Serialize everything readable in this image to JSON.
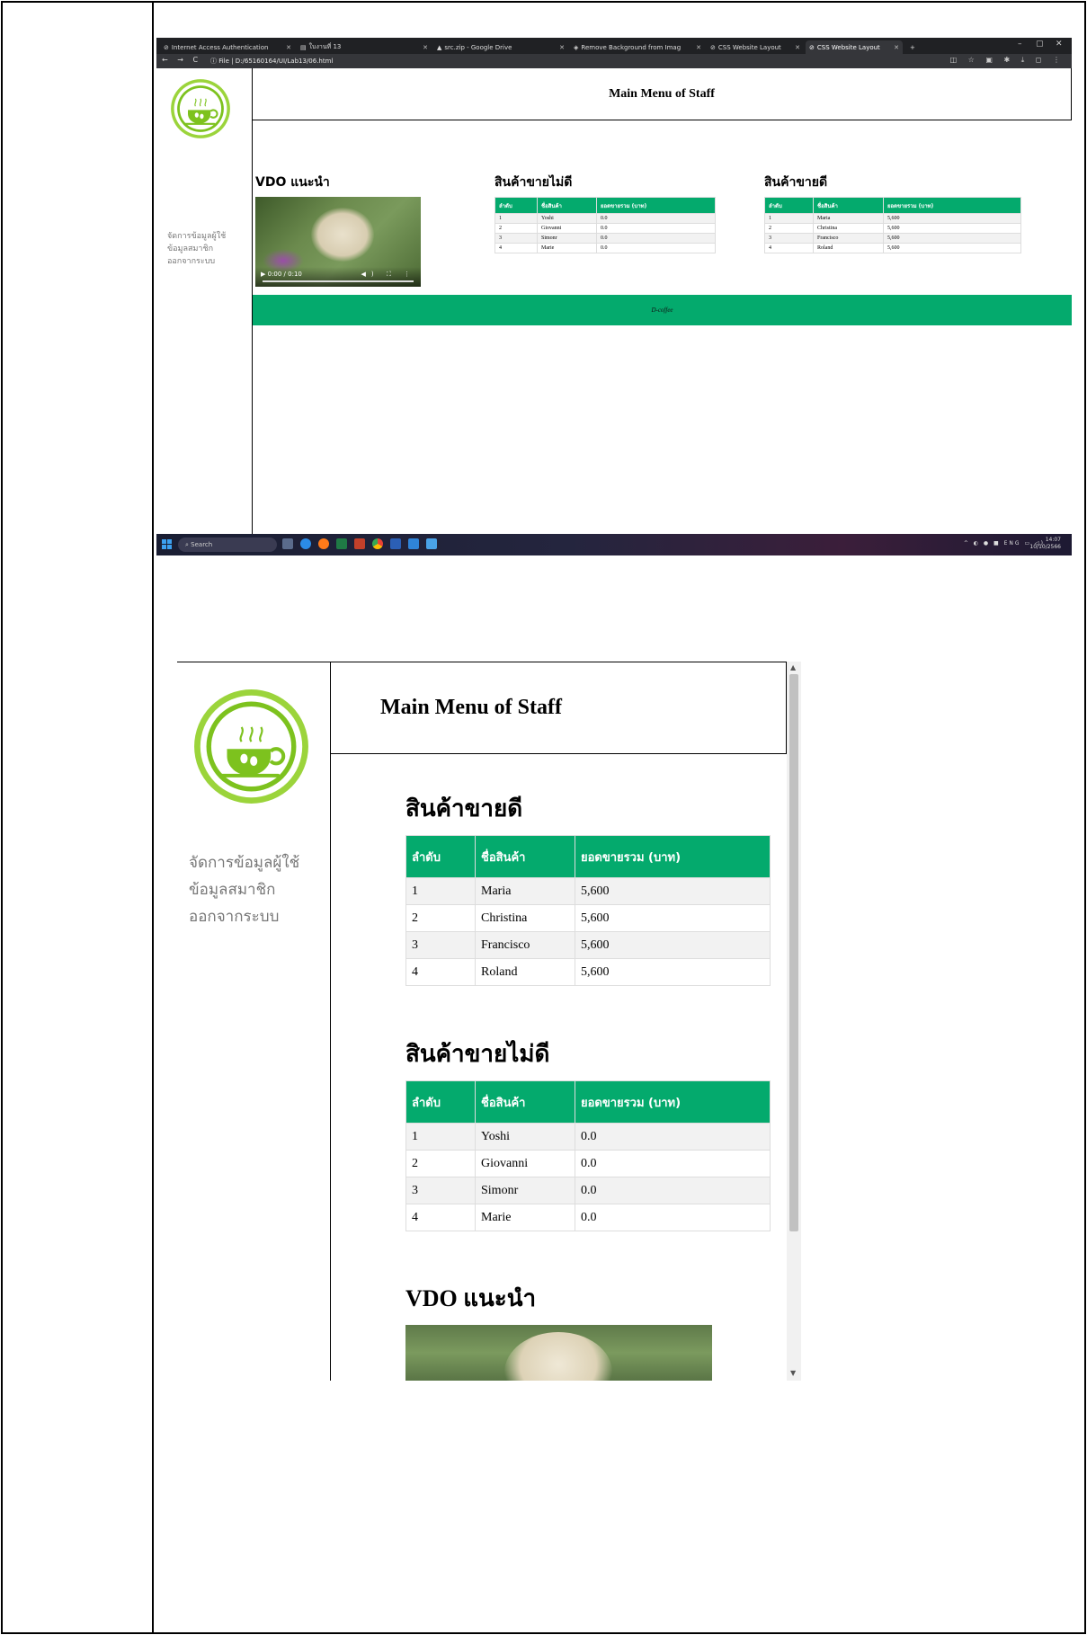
{
  "browser": {
    "tabs": [
      {
        "label": "Internet Access Authentication",
        "active": false
      },
      {
        "label": "ใบงานที่ 13",
        "active": false
      },
      {
        "label": "src.zip - Google Drive",
        "active": false
      },
      {
        "label": "Remove Background from Imag",
        "active": false
      },
      {
        "label": "CSS Website Layout",
        "active": false
      },
      {
        "label": "CSS Website Layout",
        "active": true
      }
    ],
    "new_tab": "+",
    "window_controls": {
      "minimize": "–",
      "maximize": "▢",
      "close": "✕"
    },
    "nav_glyphs": "← → C",
    "url_prefix": "ⓘ File",
    "url": "D:/65160164/UI/Lab13/06.html"
  },
  "site": {
    "header_title": "Main Menu of Staff",
    "menu_items": [
      "จัดการข้อมูลผู้ใช้",
      "ข้อมูลสมาชิก",
      "ออกจากระบบ"
    ],
    "video_heading": "VDO แนะนำ",
    "video_time": "0:00 / 0:10",
    "bad_heading": "สินค้าขายไม่ดี",
    "good_heading": "สินค้าขายดี",
    "footer_text": "D-coffee",
    "table_headers": [
      "ลำดับ",
      "ชื่อสินค้า",
      "ยอดขายรวม (บาท)"
    ],
    "bad_rows": [
      [
        "1",
        "Yoshi",
        "0.0"
      ],
      [
        "2",
        "Giovanni",
        "0.0"
      ],
      [
        "3",
        "Simonr",
        "0.0"
      ],
      [
        "4",
        "Marie",
        "0.0"
      ]
    ],
    "good_rows": [
      [
        "1",
        "Maria",
        "5,600"
      ],
      [
        "2",
        "Christina",
        "5,600"
      ],
      [
        "3",
        "Francisco",
        "5,600"
      ],
      [
        "4",
        "Roland",
        "5,600"
      ]
    ]
  },
  "taskbar": {
    "search_label": "Search",
    "tray_lang": "ENG",
    "clock_time": "14:07",
    "clock_date": "10/10/2566"
  },
  "colors": {
    "accent_green": "#04aa6d",
    "logo_green": "#7dc21e",
    "menu_gray": "#777777"
  }
}
